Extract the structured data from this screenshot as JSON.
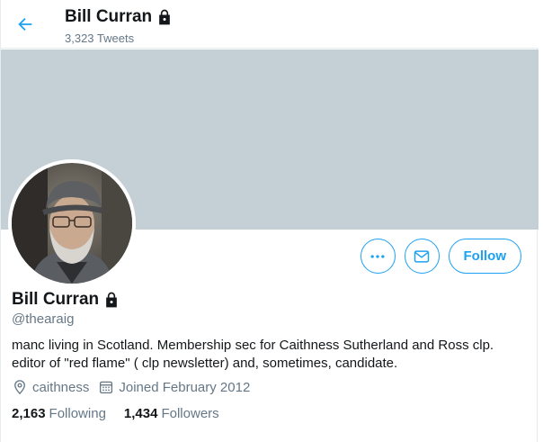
{
  "header": {
    "name": "Bill Curran",
    "tweet_count": "3,323 Tweets"
  },
  "profile": {
    "name": "Bill Curran",
    "handle": "@thearaig",
    "bio_line1": "manc living in Scotland. Membership sec for Caithness Sutherland and Ross clp.",
    "bio_line2": "editor of \"red flame\" ( clp newsletter) and, sometimes, candidate.",
    "location": "caithness",
    "joined": "Joined February 2012"
  },
  "actions": {
    "follow_label": "Follow",
    "more_icon": "more-icon",
    "message_icon": "envelope-icon"
  },
  "stats": {
    "following_count": "2,163",
    "following_label": "Following",
    "followers_count": "1,434",
    "followers_label": "Followers"
  },
  "colors": {
    "accent": "#1da1f2",
    "banner": "#c4cfd6",
    "secondary_text": "#657786"
  }
}
